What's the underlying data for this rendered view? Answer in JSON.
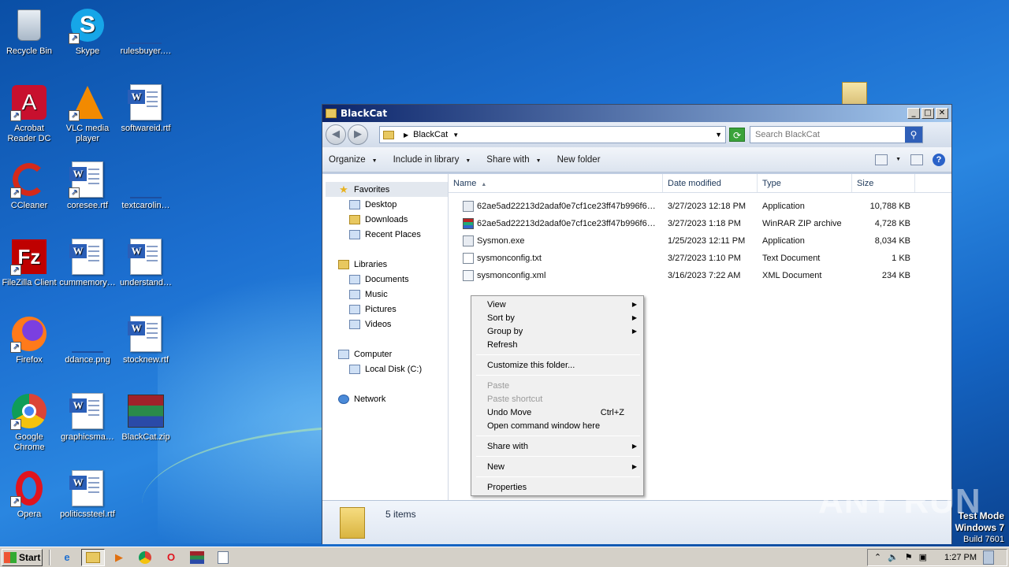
{
  "desktop": {
    "icons": [
      {
        "label": "Recycle Bin",
        "icon": "recycle-bin-icon"
      },
      {
        "label": "Skype",
        "icon": "skype-icon"
      },
      {
        "label": "rulesbuyer.…",
        "icon": "blank-file-icon"
      },
      {
        "label": "Acrobat Reader DC",
        "icon": "acrobat-icon"
      },
      {
        "label": "VLC media player",
        "icon": "vlc-icon"
      },
      {
        "label": "softwareid.rtf",
        "icon": "word-doc-icon"
      },
      {
        "label": "CCleaner",
        "icon": "ccleaner-icon"
      },
      {
        "label": "coresee.rtf",
        "icon": "word-doc-icon"
      },
      {
        "label": "textcarolin…",
        "icon": "blank-file-icon"
      },
      {
        "label": "FileZilla Client",
        "icon": "filezilla-icon"
      },
      {
        "label": "cummemory…",
        "icon": "word-doc-icon"
      },
      {
        "label": "understand…",
        "icon": "word-doc-icon"
      },
      {
        "label": "Firefox",
        "icon": "firefox-icon"
      },
      {
        "label": "ddance.png",
        "icon": "blank-file-icon"
      },
      {
        "label": "stocknew.rtf",
        "icon": "word-doc-icon"
      },
      {
        "label": "Google Chrome",
        "icon": "chrome-icon"
      },
      {
        "label": "graphicsma…",
        "icon": "word-doc-icon"
      },
      {
        "label": "BlackCat.zip",
        "icon": "winrar-icon"
      },
      {
        "label": "Opera",
        "icon": "opera-icon"
      },
      {
        "label": "politicssteel.rtf",
        "icon": "word-doc-icon"
      }
    ]
  },
  "window": {
    "title": "BlackCat",
    "address_crumb": "BlackCat",
    "search_placeholder": "Search BlackCat",
    "toolbar": {
      "organize": "Organize",
      "include": "Include in library",
      "share": "Share with",
      "new_folder": "New folder"
    },
    "nav": {
      "favorites": "Favorites",
      "desktop": "Desktop",
      "downloads": "Downloads",
      "recent": "Recent Places",
      "libraries": "Libraries",
      "documents": "Documents",
      "music": "Music",
      "pictures": "Pictures",
      "videos": "Videos",
      "computer": "Computer",
      "localdisk": "Local Disk (C:)",
      "network": "Network"
    },
    "columns": {
      "name": "Name",
      "date": "Date modified",
      "type": "Type",
      "size": "Size"
    },
    "files": [
      {
        "name": "62ae5ad22213d2adaf0e7cf1ce23ff47b996f6…",
        "date": "3/27/2023 12:18 PM",
        "type": "Application",
        "size": "10,788 KB",
        "icon": "exe"
      },
      {
        "name": "62ae5ad22213d2adaf0e7cf1ce23ff47b996f6…",
        "date": "3/27/2023 1:18 PM",
        "type": "WinRAR ZIP archive",
        "size": "4,728 KB",
        "icon": "rar"
      },
      {
        "name": "Sysmon.exe",
        "date": "1/25/2023 12:11 PM",
        "type": "Application",
        "size": "8,034 KB",
        "icon": "exe"
      },
      {
        "name": "sysmonconfig.txt",
        "date": "3/27/2023 1:10 PM",
        "type": "Text Document",
        "size": "1 KB",
        "icon": "txt"
      },
      {
        "name": "sysmonconfig.xml",
        "date": "3/16/2023 7:22 AM",
        "type": "XML Document",
        "size": "234 KB",
        "icon": "xml"
      }
    ],
    "status": "5 items"
  },
  "context_menu": {
    "view": "View",
    "sort_by": "Sort by",
    "group_by": "Group by",
    "refresh": "Refresh",
    "customize": "Customize this folder...",
    "paste": "Paste",
    "paste_shortcut": "Paste shortcut",
    "undo_move": "Undo Move",
    "undo_shortcut": "Ctrl+Z",
    "open_cmd": "Open command window here",
    "share_with": "Share with",
    "new": "New",
    "properties": "Properties"
  },
  "watermark": "ANY RUN",
  "testmode": {
    "line1": "Test Mode",
    "line2": "Windows 7",
    "line3": "Build 7601"
  },
  "taskbar": {
    "start": "Start",
    "clock": "1:27 PM"
  }
}
